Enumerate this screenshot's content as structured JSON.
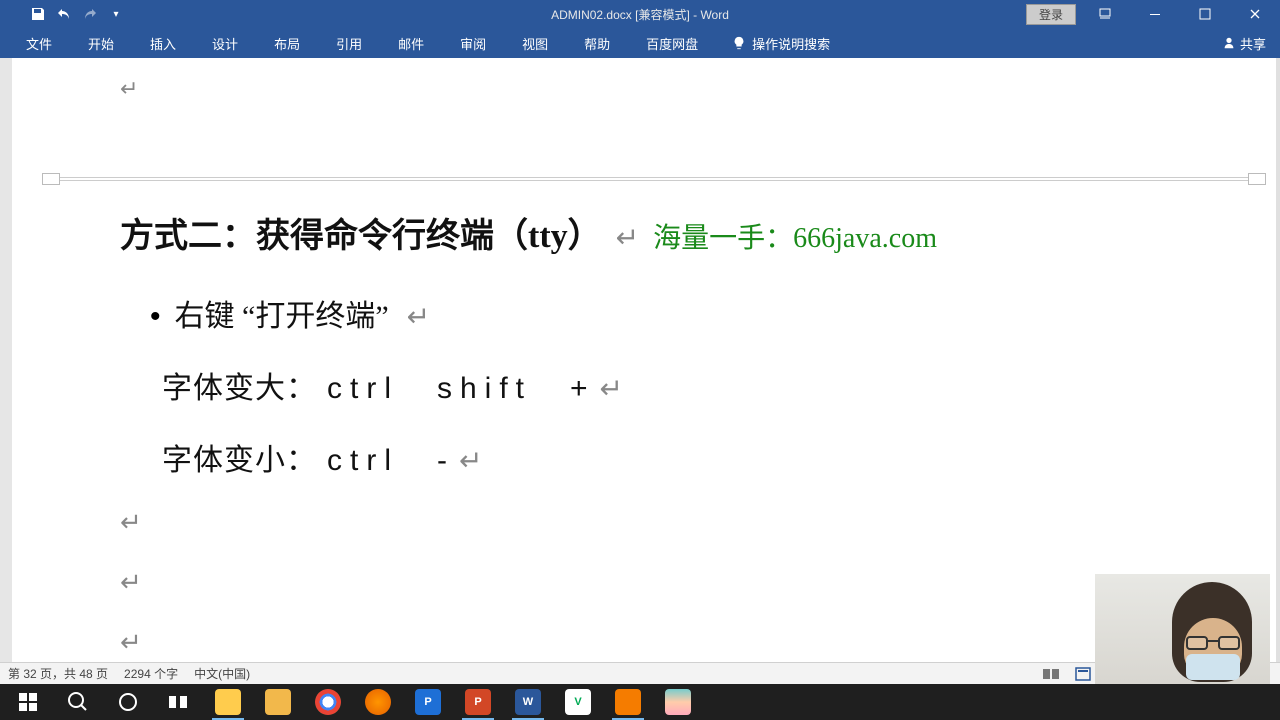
{
  "title": "ADMIN02.docx [兼容模式] - Word",
  "login_label": "登录",
  "ribbon": {
    "tabs": [
      "文件",
      "开始",
      "插入",
      "设计",
      "布局",
      "引用",
      "邮件",
      "审阅",
      "视图",
      "帮助",
      "百度网盘"
    ],
    "tell_me": "操作说明搜索",
    "share": "共享"
  },
  "document": {
    "heading": "方式二：获得命令行终端（tty）",
    "watermark": "海量一手：666java.com",
    "bullet": "右键 “打开终端”",
    "line_bigger_label": "字体变大：",
    "line_bigger_keys": "ctrl　shift　+",
    "line_smaller_label": "字体变小：",
    "line_smaller_keys": "ctrl　-",
    "soft_return": "↵"
  },
  "status": {
    "page_info": "第 32 页，共 48 页",
    "word_count": "2294 个字",
    "language": "中文(中国)"
  },
  "zoom": {
    "minus": "−",
    "plus": "+"
  }
}
